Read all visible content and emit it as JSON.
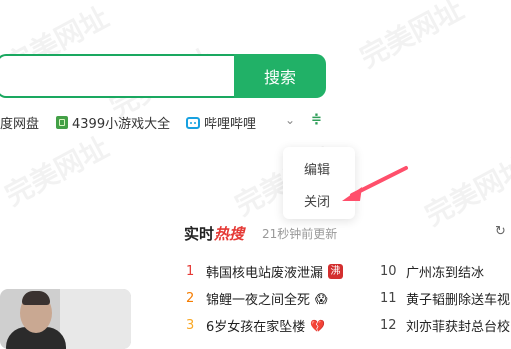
{
  "watermark": "完美网址",
  "search": {
    "button_label": "搜索",
    "placeholder": ""
  },
  "shortcuts": [
    {
      "label": "度网盘",
      "icon": "cloud-disk-icon"
    },
    {
      "label": "4399小游戏大全",
      "icon": "4399-icon"
    },
    {
      "label": "哔哩哔哩",
      "icon": "bilibili-icon"
    }
  ],
  "context_menu": {
    "items": [
      "编辑",
      "关闭"
    ]
  },
  "hot_search": {
    "title_prefix": "实时",
    "title_suffix": "热搜",
    "updated": "21秒钟前更新",
    "left": [
      {
        "rank": "1",
        "text": "韩国核电站废液泄漏",
        "badge": "沸",
        "rank_color": "#e53935"
      },
      {
        "rank": "2",
        "text": "锦鲤一夜之间全死",
        "emoji": "😱",
        "rank_color": "#f57c00"
      },
      {
        "rank": "3",
        "text": "6岁女孩在家坠楼",
        "emoji": "💔",
        "rank_color": "#f9a825"
      }
    ],
    "right": [
      {
        "rank": "10",
        "text": "广州冻到结冰"
      },
      {
        "rank": "11",
        "text": "黄子韬删除送车视"
      },
      {
        "rank": "12",
        "text": "刘亦菲获封总台校"
      }
    ]
  },
  "colors": {
    "brand_green": "#21b167",
    "hot_red": "#e53935",
    "arrow_red": "#ff4f6b"
  }
}
